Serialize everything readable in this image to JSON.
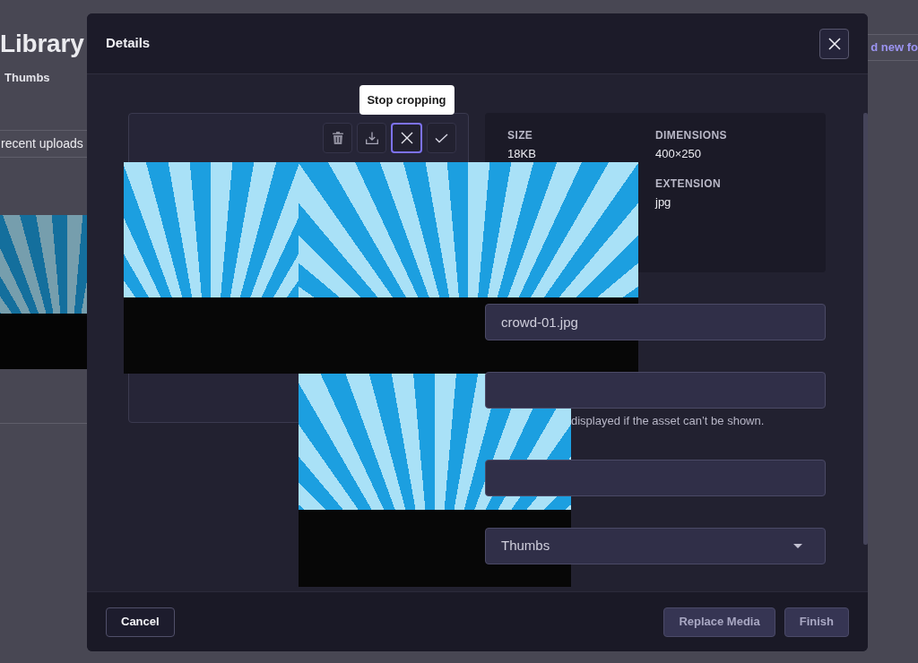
{
  "background_page": {
    "title": "Library",
    "breadcrumb": "Thumbs",
    "filter_button": "recent uploads",
    "folder_button": "d new fo"
  },
  "dialog": {
    "title": "Details"
  },
  "crop_toolbar": {
    "buttons": [
      {
        "kind": "delete",
        "focused": false
      },
      {
        "kind": "download",
        "focused": false
      },
      {
        "kind": "stop_cropping",
        "focused": true
      },
      {
        "kind": "apply",
        "focused": false
      }
    ],
    "tooltip": "Stop cropping"
  },
  "info_columns": [
    [
      {
        "label": "SIZE",
        "value": "18KB"
      }
    ],
    [
      {
        "label": "DIMENSIONS",
        "value": "400×250"
      },
      {
        "label": "EXTENSION",
        "value": "jpg"
      }
    ]
  ],
  "fields": [
    {
      "kind": "input",
      "value": "crowd-01.jpg"
    },
    {
      "kind": "input",
      "help": "displayed if the asset can’t be shown."
    },
    {
      "kind": "input"
    },
    {
      "kind": "select",
      "value": "Thumbs"
    }
  ],
  "footer": {
    "cancel": "Cancel",
    "actions": [
      "Replace Media",
      "Finish"
    ]
  }
}
